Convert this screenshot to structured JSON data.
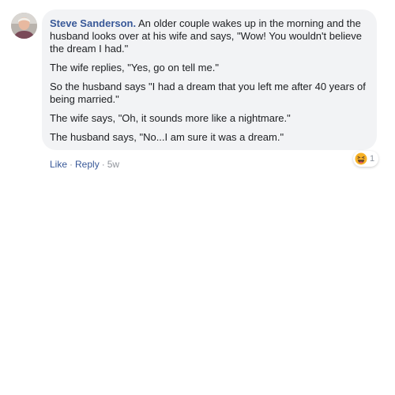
{
  "comment": {
    "author": "Steve Sanderson.",
    "paragraphs": [
      "An older couple wakes up in the morning and the husband looks over at his wife and says, \"Wow! You wouldn't believe the dream I had.\"",
      "The wife replies, \"Yes, go on tell me.\"",
      "So the husband says \"I had a dream that you left me after 40 years of being married.\"",
      "The wife says, \"Oh, it sounds more like a nightmare.\"",
      "The husband says, \"No...I am sure it was a dream.\""
    ],
    "reaction": {
      "icon": "haha-reaction-icon",
      "count": "1",
      "color": "#f7b125"
    },
    "actions": {
      "like": "Like",
      "separator": "·",
      "reply": "Reply",
      "time": "5w"
    }
  },
  "colors": {
    "author": "#385898",
    "bubble": "#f2f3f5",
    "text": "#1c1e21",
    "meta": "#90949c"
  }
}
